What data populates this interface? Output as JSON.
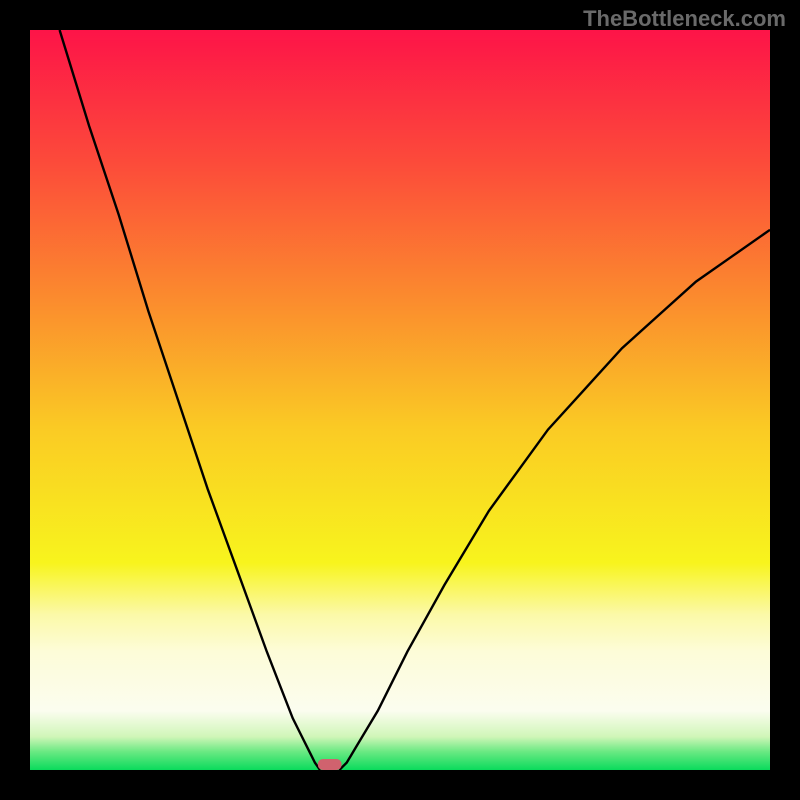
{
  "watermark": "TheBottleneck.com",
  "chart_data": {
    "type": "line",
    "title": "",
    "xlabel": "",
    "ylabel": "",
    "xlim": [
      0,
      100
    ],
    "ylim": [
      0,
      100
    ],
    "grid": false,
    "legend": false,
    "gradient_description": "vertical gradient from red (top) through orange, yellow, pale yellow to green (bottom)",
    "series": [
      {
        "name": "left-branch",
        "x": [
          4,
          8,
          12,
          16,
          20,
          24,
          28,
          32,
          35.5,
          37.5,
          38.5,
          39.2
        ],
        "y": [
          100,
          87,
          75,
          62,
          50,
          38,
          27,
          16,
          7,
          3,
          1,
          0
        ]
      },
      {
        "name": "right-branch",
        "x": [
          41.8,
          42.8,
          44,
          47,
          51,
          56,
          62,
          70,
          80,
          90,
          100
        ],
        "y": [
          0,
          1,
          3,
          8,
          16,
          25,
          35,
          46,
          57,
          66,
          73
        ]
      }
    ],
    "marker": {
      "name": "bottom-marker",
      "x_center": 40.5,
      "width": 3.2,
      "color": "#d0626e",
      "y": 0
    },
    "gradient_stops": [
      {
        "offset": 0,
        "color": "#fd1448"
      },
      {
        "offset": 18,
        "color": "#fc4b3a"
      },
      {
        "offset": 36,
        "color": "#fb8a2e"
      },
      {
        "offset": 54,
        "color": "#facb24"
      },
      {
        "offset": 72,
        "color": "#f8f41d"
      },
      {
        "offset": 79,
        "color": "#fbf9a8"
      },
      {
        "offset": 84,
        "color": "#fdfcd8"
      },
      {
        "offset": 92,
        "color": "#fbfdef"
      },
      {
        "offset": 95.5,
        "color": "#d0f6b8"
      },
      {
        "offset": 97.5,
        "color": "#6be983"
      },
      {
        "offset": 100,
        "color": "#0adb5c"
      }
    ]
  }
}
